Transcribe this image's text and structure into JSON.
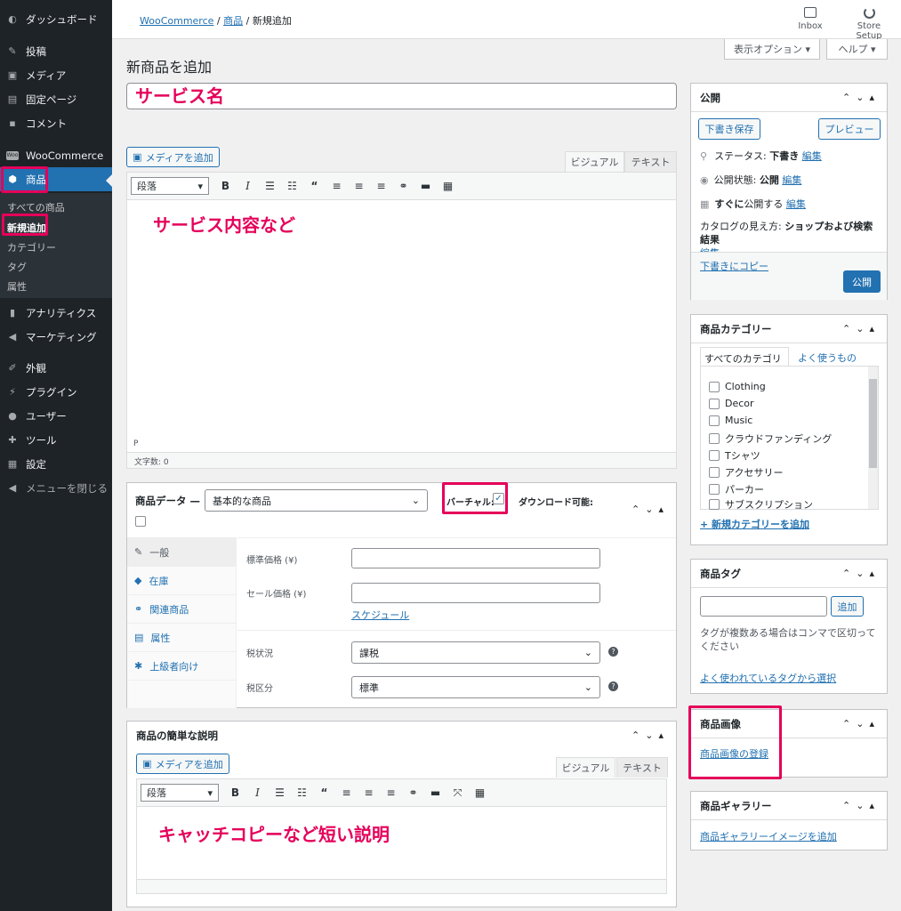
{
  "sidebar": {
    "items": [
      {
        "label": "ダッシュボード"
      },
      {
        "label": "投稿"
      },
      {
        "label": "メディア"
      },
      {
        "label": "固定ページ"
      },
      {
        "label": "コメント"
      },
      {
        "label": "WooCommerce"
      },
      {
        "label": "商品"
      },
      {
        "label": "アナリティクス"
      },
      {
        "label": "マーケティング"
      },
      {
        "label": "外観"
      },
      {
        "label": "プラグイン"
      },
      {
        "label": "ユーザー"
      },
      {
        "label": "ツール"
      },
      {
        "label": "設定"
      },
      {
        "label": "メニューを閉じる"
      }
    ],
    "woo_badge": "Woo",
    "submenu": [
      "すべての商品",
      "新規追加",
      "カテゴリー",
      "タグ",
      "属性"
    ]
  },
  "header": {
    "breadcrumb": [
      "WooCommerce",
      "商品",
      "新規追加"
    ],
    "sep": "/",
    "inbox": "Inbox",
    "store_setup": "Store Setup",
    "screen_options": "表示オプション ▾",
    "help": "ヘルプ ▾"
  },
  "page_title": "新商品を追加",
  "annotations": {
    "service_name": "サービス名",
    "service_content": "サービス内容など",
    "catch_copy": "キャッチコピーなど短い説明"
  },
  "editor": {
    "add_media": "メディアを追加",
    "tab_visual": "ビジュアル",
    "tab_text": "テキスト",
    "paragraph": "段落",
    "path": "P",
    "word_count": "文字数: 0"
  },
  "product_data": {
    "title": "商品データ —",
    "type": "基本的な商品",
    "virtual": "バーチャル:",
    "downloadable": "ダウンロード可能:",
    "tabs": [
      "一般",
      "在庫",
      "関連商品",
      "属性",
      "上級者向け"
    ],
    "regular_price": "標準価格 (¥)",
    "sale_price": "セール価格 (¥)",
    "schedule": "スケジュール",
    "tax_status_label": "税状況",
    "tax_status": "課税",
    "tax_class_label": "税区分",
    "tax_class": "標準"
  },
  "short_desc": {
    "title": "商品の簡単な説明",
    "add_media": "メディアを追加",
    "tab_visual": "ビジュアル",
    "tab_text": "テキスト",
    "paragraph": "段落"
  },
  "publish": {
    "title": "公開",
    "save_draft": "下書き保存",
    "preview": "プレビュー",
    "status_label": "ステータス:",
    "status_value": "下書き",
    "visibility_label": "公開状態:",
    "visibility_value": "公開",
    "schedule_prefix": "すぐに",
    "schedule_suffix": "公開する",
    "edit": "編集",
    "catalog_label": "カタログの見え方:",
    "catalog_value": "ショップおよび検索結果",
    "copy_draft": "下書きにコピー",
    "publish_btn": "公開"
  },
  "categories": {
    "title": "商品カテゴリー",
    "tab_all": "すべてのカテゴリー",
    "tab_popular": "よく使うもの",
    "items": [
      "Clothing",
      "Decor",
      "Music",
      "クラウドファンディング",
      "Tシャツ",
      "アクセサリー",
      "パーカー",
      "サブスクリプション"
    ],
    "add_new": "+ 新規カテゴリーを追加"
  },
  "tags": {
    "title": "商品タグ",
    "add_btn": "追加",
    "hint": "タグが複数ある場合はコンマで区切ってください",
    "choose": "よく使われているタグから選択"
  },
  "image": {
    "title": "商品画像",
    "set": "商品画像の登録"
  },
  "gallery": {
    "title": "商品ギャラリー",
    "add": "商品ギャラリーイメージを追加"
  },
  "colors": {
    "accent": "#2271b1",
    "sidebar": "#1d2327",
    "highlight": "#e5005a"
  }
}
